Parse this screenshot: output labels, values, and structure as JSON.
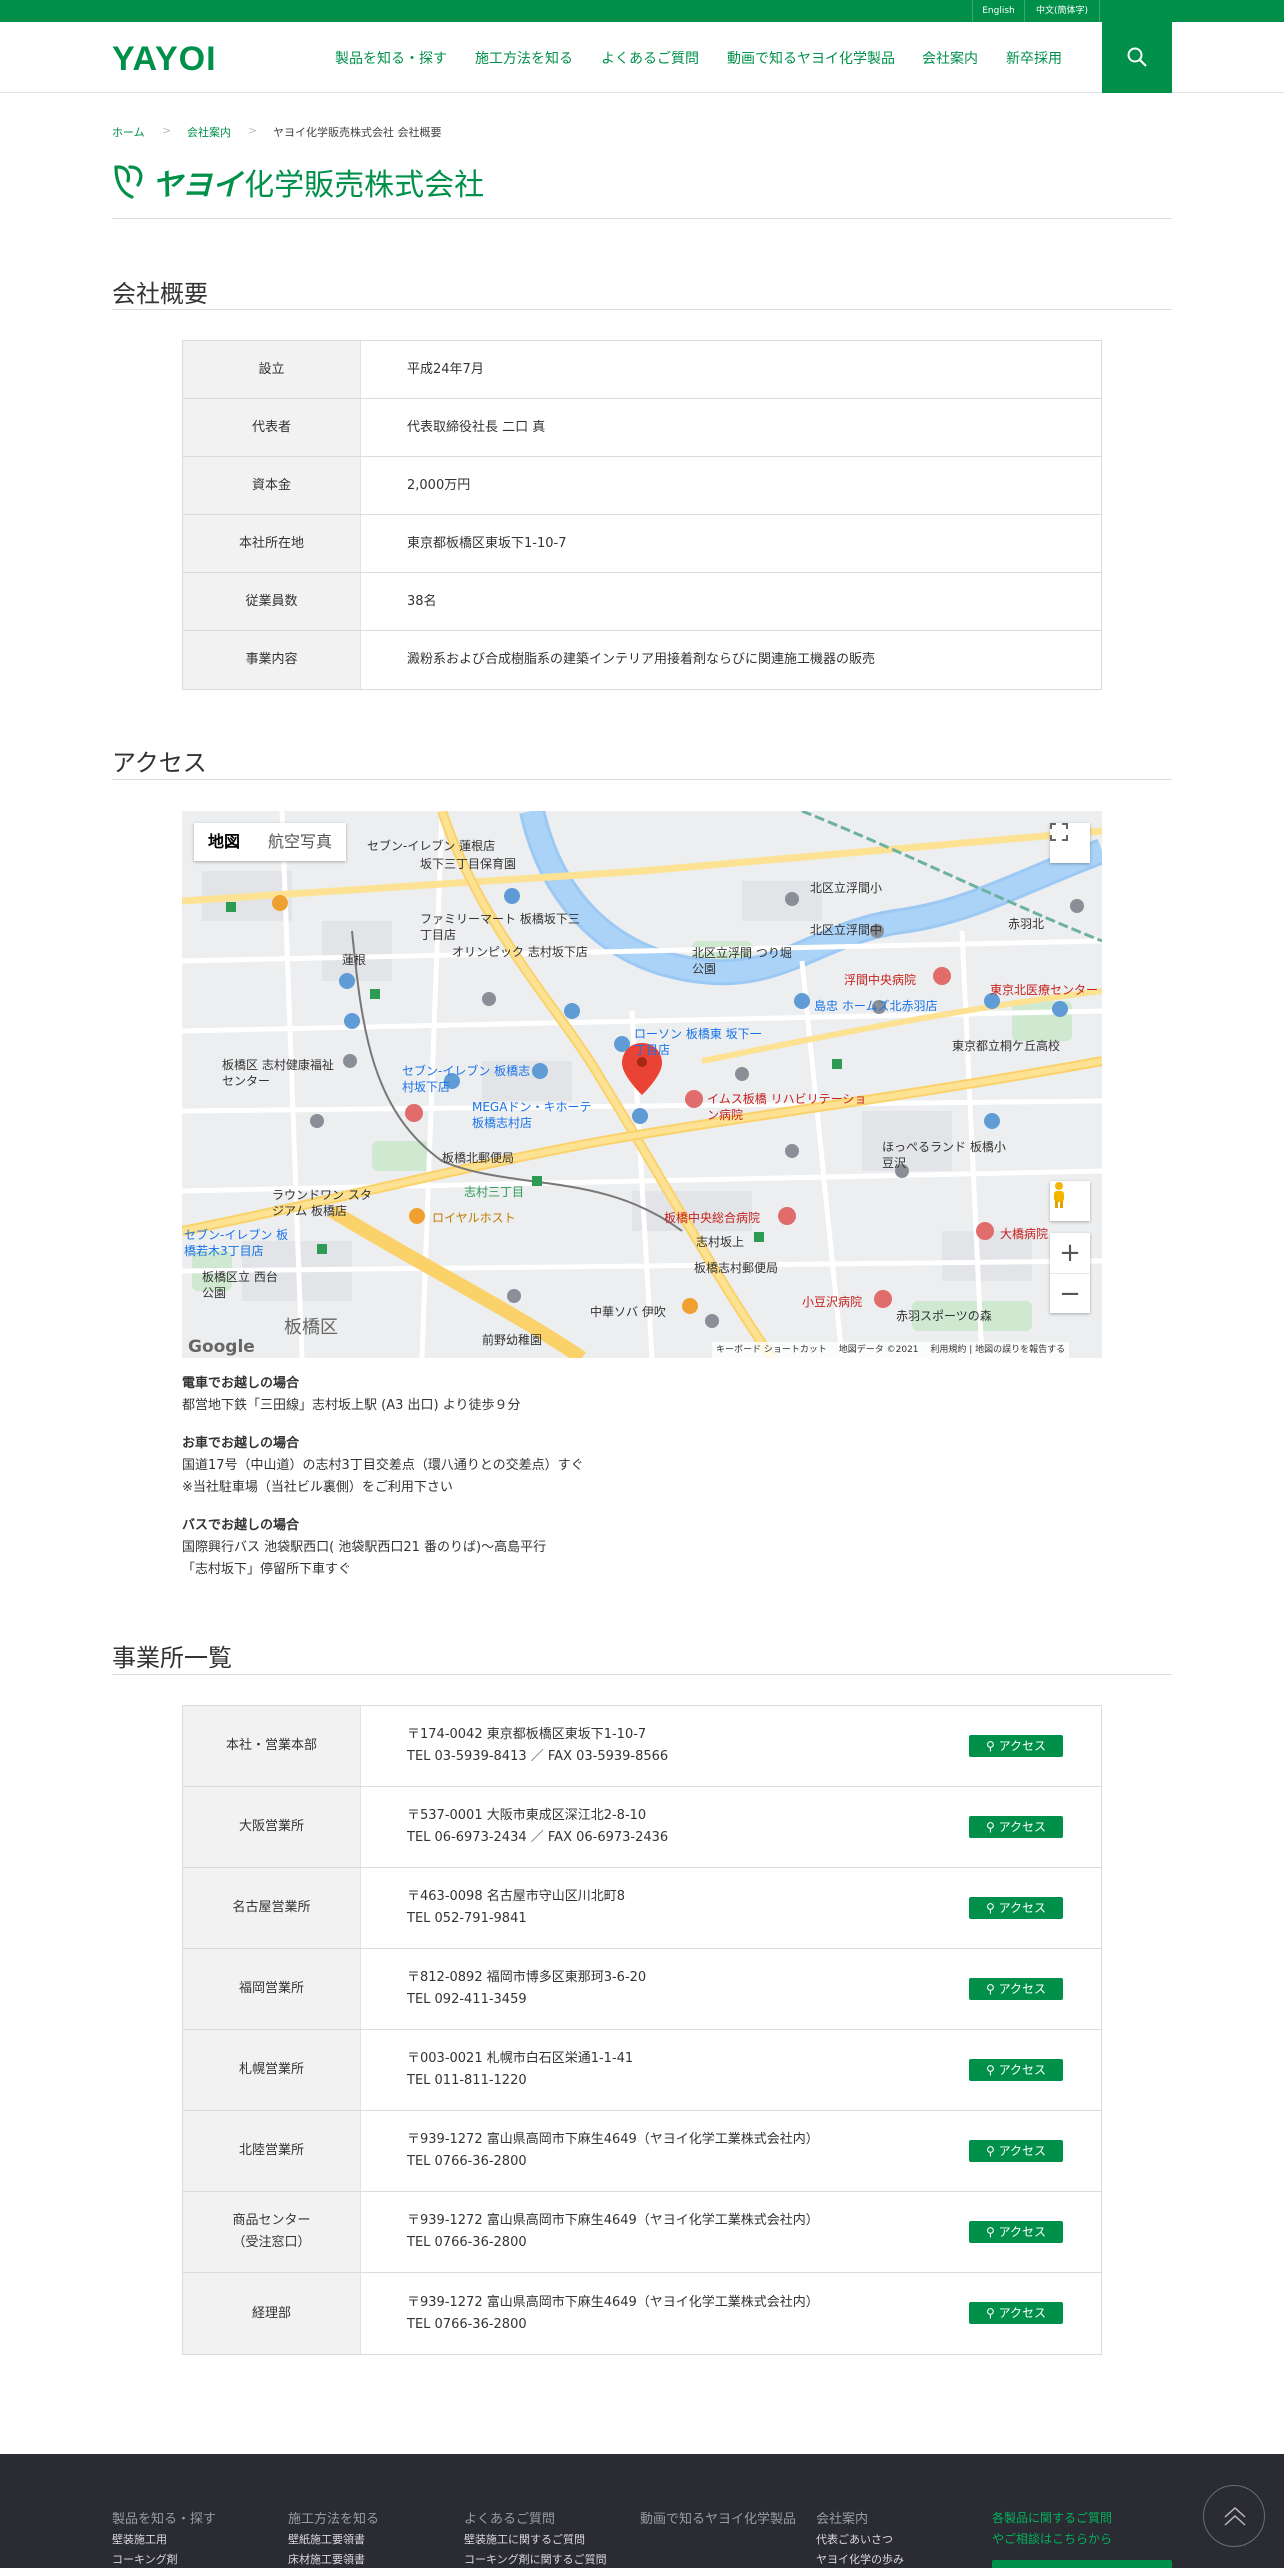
{
  "topbar": {
    "lang_en": "English",
    "lang_zh": "中文(簡体字)"
  },
  "header": {
    "logo": "YAYOI",
    "nav": [
      "製品を知る・探す",
      "施工方法を知る",
      "よくあるご質問",
      "動画で知るヤヨイ化学製品",
      "会社案内",
      "新卒採用"
    ],
    "search_icon": "search-icon"
  },
  "breadcrumb": [
    "ホーム",
    "会社案内",
    "ヤヨイ化学販売株式会社 会社概要"
  ],
  "brand": {
    "katakana": "ヤヨイ",
    "name": "化学販売株式会社"
  },
  "overview": {
    "heading": "会社概要",
    "rows": [
      {
        "label": "設立",
        "value": "平成24年7月"
      },
      {
        "label": "代表者",
        "value": "代表取締役社長 二口 真"
      },
      {
        "label": "資本金",
        "value": "2,000万円"
      },
      {
        "label": "本社所在地",
        "value": "東京都板橋区東坂下1-10-7"
      },
      {
        "label": "従業員数",
        "value": "38名"
      },
      {
        "label": "事業内容",
        "value": "澱粉系および合成樹脂系の建築インテリア用接着剤ならびに関連施工機器の販売"
      }
    ]
  },
  "access": {
    "heading": "アクセス",
    "map": {
      "tab_map": "地図",
      "tab_satellite": "航空写真",
      "footer_shortcuts": "キーボード ショートカット",
      "footer_data": "地図データ ©2021",
      "footer_terms": "利用規約",
      "footer_report": "地図の誤りを報告する",
      "google": "Google",
      "labels": [
        "セブン-イレブン 蓮根店",
        "坂下三丁目保育園",
        "ファミリーマート 板橋坂下三丁目店",
        "オリンピック 志村坂下店",
        "北区立浮間 つり堀公園",
        "浮間中央病院",
        "東京北医療センター",
        "島忠 ホームズ北赤羽店",
        "ローソン 板橋東 坂下一丁目店",
        "東京都立桐ケ丘高校",
        "セブン-イレブン 板橋志村坂下店",
        "MEGAドン・キホーテ 板橋志村店",
        "イムス板橋 リハビリテーション病院",
        "ほっぺるランド 板橋小豆沢",
        "板橋区 志村健康福祉センター",
        "板橋北郵便局",
        "志村三丁目",
        "ラウンドワン スタジアム 板橋店",
        "ロイヤルホスト",
        "板橋中央総合病院",
        "大橋病院",
        "セブン-イレブン 板橋若木3丁目店",
        "小豆沢病院",
        "赤羽スポーツの森",
        "中華ソバ 伊吹",
        "板橋区",
        "志村坂上",
        "板橋志村郵便局",
        "前野幼稚園",
        "北区立浮間小",
        "北区立浮間中",
        "赤羽北",
        "板橋区立 西台公園",
        "蓮根"
      ]
    },
    "directions": [
      {
        "title": "電車でお越しの場合",
        "lines": [
          "都営地下鉄「三田線」志村坂上駅 (A3 出口) より徒歩９分"
        ]
      },
      {
        "title": "お車でお越しの場合",
        "lines": [
          "国道17号（中山道）の志村3丁目交差点（環八通りとの交差点）すぐ",
          "※当社駐車場（当社ビル裏側）をご利用下さい"
        ]
      },
      {
        "title": "バスでお越しの場合",
        "lines": [
          "国際興行バス 池袋駅西口( 池袋駅西口21 番のりば)～高島平行",
          "「志村坂下」停留所下車すぐ"
        ]
      }
    ]
  },
  "offices": {
    "heading": "事業所一覧",
    "button_label": "アクセス",
    "rows": [
      {
        "label": [
          "本社・営業本部"
        ],
        "address": "〒174-0042 東京都板橋区東坂下1-10-7",
        "tel": "TEL 03-5939-8413 ／ FAX 03-5939-8566"
      },
      {
        "label": [
          "大阪営業所"
        ],
        "address": "〒537-0001 大阪市東成区深江北2-8-10",
        "tel": "TEL 06-6973-2434 ／ FAX 06-6973-2436"
      },
      {
        "label": [
          "名古屋営業所"
        ],
        "address": "〒463-0098 名古屋市守山区川北町8",
        "tel": "TEL 052-791-9841"
      },
      {
        "label": [
          "福岡営業所"
        ],
        "address": "〒812-0892 福岡市博多区東那珂3-6-20",
        "tel": "TEL 092-411-3459"
      },
      {
        "label": [
          "札幌営業所"
        ],
        "address": "〒003-0021 札幌市白石区栄通1-1-41",
        "tel": "TEL 011-811-1220"
      },
      {
        "label": [
          "北陸営業所"
        ],
        "address": "〒939-1272 富山県高岡市下麻生4649（ヤヨイ化学工業株式会社内）",
        "tel": "TEL 0766-36-2800"
      },
      {
        "label": [
          "商品センター",
          "（受注窓口）"
        ],
        "address": "〒939-1272 富山県高岡市下麻生4649（ヤヨイ化学工業株式会社内）",
        "tel": "TEL 0766-36-2800"
      },
      {
        "label": [
          "経理部"
        ],
        "address": "〒939-1272 富山県高岡市下麻生4649（ヤヨイ化学工業株式会社内）",
        "tel": "TEL 0766-36-2800"
      }
    ]
  },
  "footer": {
    "cols": [
      {
        "title": "製品を知る・探す",
        "items": [
          "壁装施工用",
          "コーキング剤"
        ]
      },
      {
        "title": "施工方法を知る",
        "items": [
          "壁紙施工要領書",
          "床材施工要領書"
        ]
      },
      {
        "title": "よくあるご質問",
        "items": [
          "壁装施工に関するご質問",
          "コーキング剤に関するご質問"
        ]
      },
      {
        "title": "動画で知るヤヨイ化学製品",
        "items": []
      },
      {
        "title": "会社案内",
        "items": [
          "代表ごあいさつ",
          "ヤヨイ化学の歩み"
        ]
      }
    ],
    "note": "各製品に関するご質問やご相談はこちらから",
    "colors": {
      "brand": "#00904a",
      "footer_bg": "#2b2b33"
    }
  }
}
